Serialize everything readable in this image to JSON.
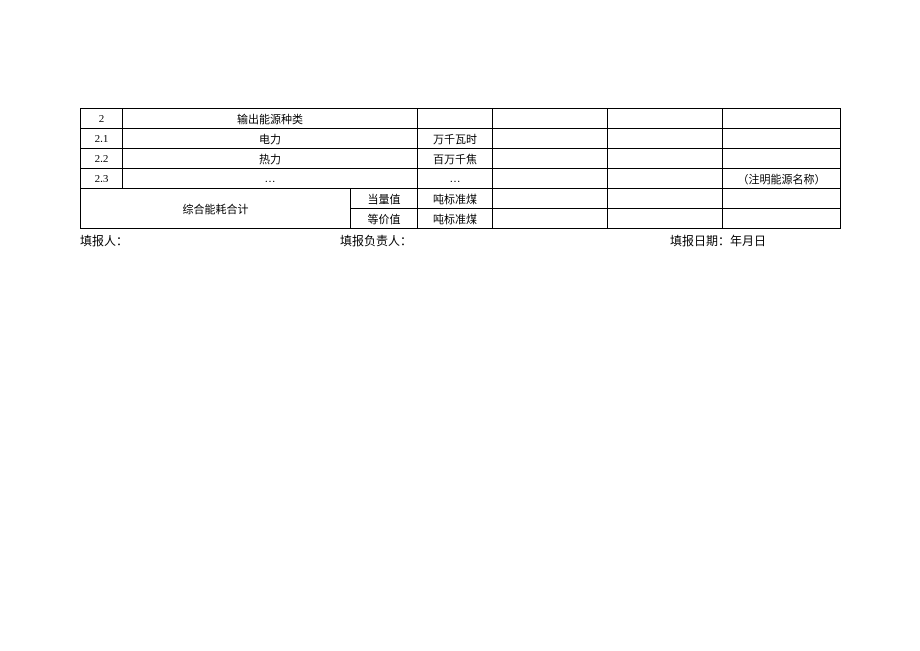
{
  "table": {
    "rows": [
      {
        "idx": "2",
        "name": "输出能源种类",
        "unit": "",
        "note": ""
      },
      {
        "idx": "2.1",
        "name": "电力",
        "unit": "万千瓦时",
        "note": ""
      },
      {
        "idx": "2.2",
        "name": "热力",
        "unit": "百万千焦",
        "note": ""
      },
      {
        "idx": "2.3",
        "name": "…",
        "unit": "…",
        "note": "（注明能源名称）"
      }
    ],
    "summary": {
      "label": "综合能耗合计",
      "sub1": "当量值",
      "sub2": "等价值",
      "unit1": "吨标准煤",
      "unit2": "吨标准煤"
    }
  },
  "footer": {
    "reporter": "填报人：",
    "responsible": "填报负责人：",
    "date": "填报日期：年月日"
  }
}
